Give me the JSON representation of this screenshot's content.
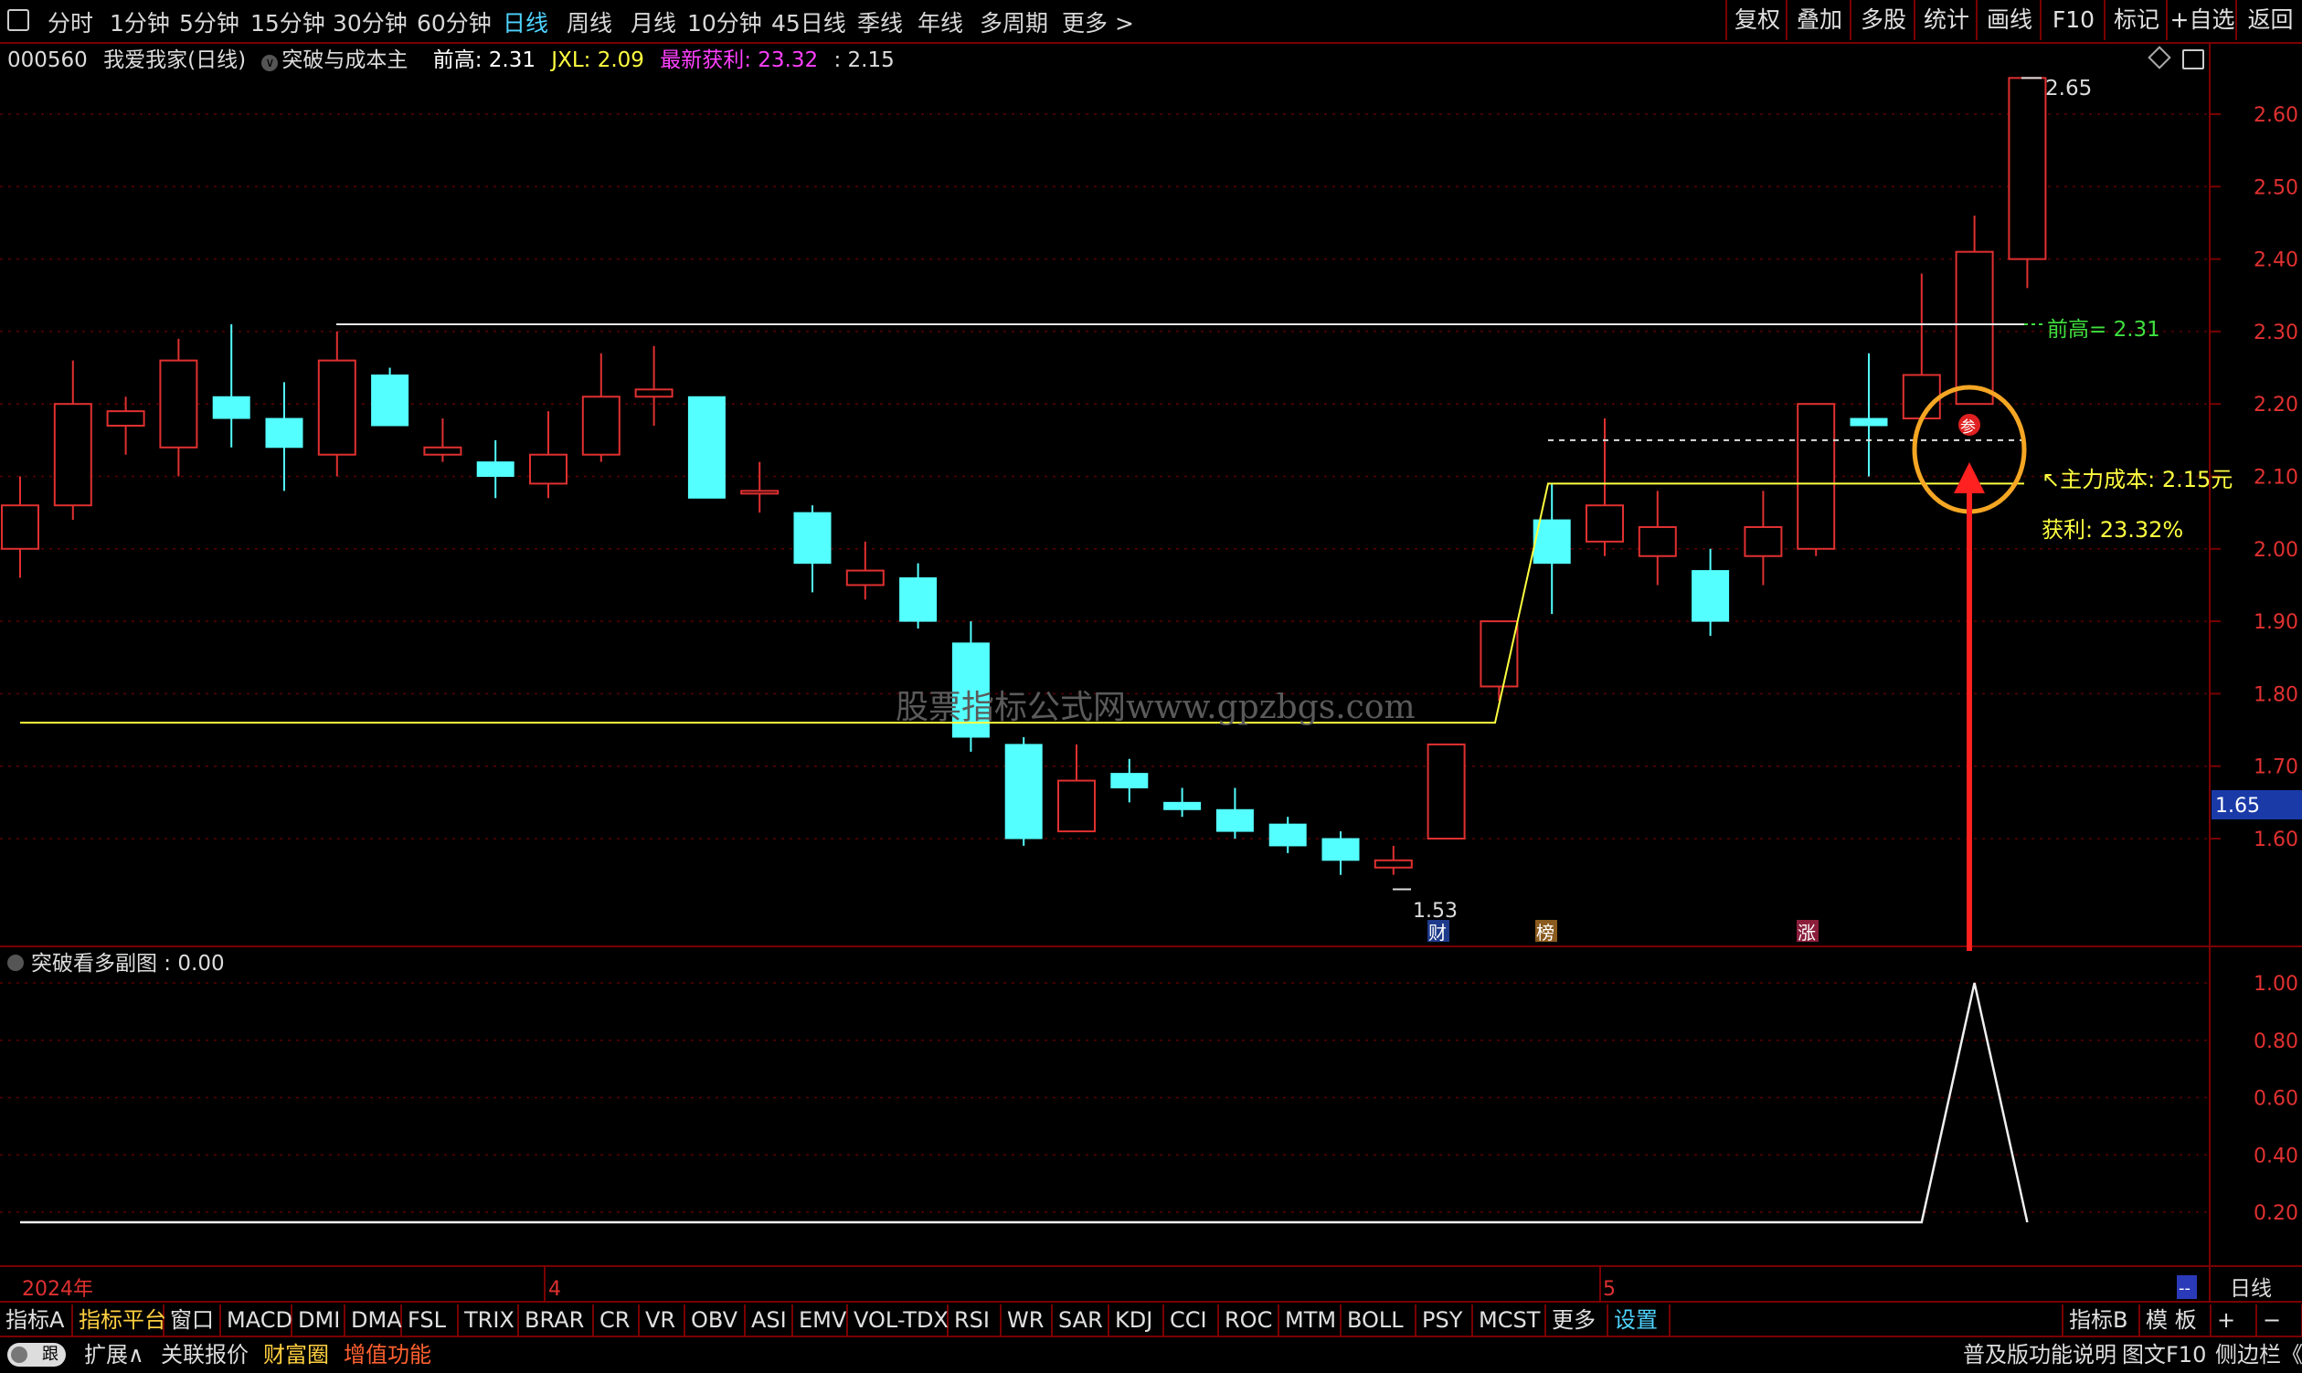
{
  "toolbar": {
    "periods": [
      "分时",
      "1分钟",
      "5分钟",
      "15分钟",
      "30分钟",
      "60分钟",
      "日线",
      "周线",
      "月线",
      "10分钟",
      "45日线",
      "季线",
      "年线",
      "多周期",
      "更多 >"
    ],
    "active_period": "日线",
    "right_buttons": [
      "复权",
      "叠加",
      "多股",
      "统计",
      "画线",
      "F10",
      "标记",
      "+自选",
      "返回"
    ]
  },
  "info": {
    "code": "000560",
    "name": "我爱我家(日线)",
    "indicator": "突破与成本主",
    "prev_high_label": "前高: 2.31",
    "jxl_label": "JXL: 2.09",
    "profit_label": "最新获利: 23.32",
    "extra_label": ": 2.15"
  },
  "price_axis": {
    "ticks": [
      "2.60",
      "2.50",
      "2.40",
      "2.30",
      "2.20",
      "2.10",
      "2.00",
      "1.90",
      "1.80",
      "1.70",
      "1.60"
    ],
    "current_price": "1.65"
  },
  "annotations": {
    "high_label": "2.65",
    "low_label": "1.53",
    "prev_high": "前高= 2.31",
    "cost": "主力成本: 2.15元",
    "profit": "获利: 23.32%",
    "watermark": "股票指标公式网www.gpzbgs.com",
    "badge_cai": "财",
    "badge_bang": "榜",
    "badge_zhang": "涨",
    "badge_can": "参"
  },
  "sub_panel": {
    "title": "突破看多副图 : 0.00",
    "ticks": [
      "1.00",
      "0.80",
      "0.60",
      "0.40",
      "0.20"
    ]
  },
  "time_axis": {
    "year": "2024年",
    "m4": "4",
    "m5": "5",
    "period": "日线",
    "dash": "--"
  },
  "bottom_tabs": [
    "指标A",
    "指标平台",
    "窗口",
    "MACD",
    "DMI",
    "DMA",
    "FSL",
    "TRIX",
    "BRAR",
    "CR",
    "VR",
    "OBV",
    "ASI",
    "EMV",
    "VOL-TDX",
    "RSI",
    "WR",
    "SAR",
    "KDJ",
    "CCI",
    "ROC",
    "MTM",
    "BOLL",
    "PSY",
    "MCST",
    "更多",
    "设置"
  ],
  "bottom_right": [
    "指标B",
    "模 板",
    "+",
    "−"
  ],
  "status": {
    "toggle": "跟",
    "expand": "扩展∧",
    "quote": "关联报价",
    "wealth": "财富圈",
    "value_add": "增值功能",
    "help": "普及版功能说明",
    "f10": "图文F10",
    "side": "侧边栏《"
  },
  "colors": {
    "up": "#e03030",
    "down": "#54ffff",
    "line_yellow": "#ffff40",
    "accent": "#4fd4ff"
  },
  "chart_data": {
    "type": "candlestick",
    "price_range": [
      1.5,
      2.7
    ],
    "candles": [
      [
        2.0,
        2.06,
        2.1,
        1.96
      ],
      [
        2.06,
        2.2,
        2.26,
        2.04
      ],
      [
        2.17,
        2.19,
        2.21,
        2.13
      ],
      [
        2.14,
        2.26,
        2.29,
        2.1
      ],
      [
        2.21,
        2.18,
        2.31,
        2.14
      ],
      [
        2.18,
        2.14,
        2.23,
        2.08
      ],
      [
        2.13,
        2.26,
        2.3,
        2.1
      ],
      [
        2.24,
        2.17,
        2.25,
        2.17
      ],
      [
        2.13,
        2.14,
        2.18,
        2.12
      ],
      [
        2.12,
        2.1,
        2.15,
        2.07
      ],
      [
        2.09,
        2.13,
        2.19,
        2.07
      ],
      [
        2.13,
        2.21,
        2.27,
        2.12
      ],
      [
        2.21,
        2.22,
        2.28,
        2.17
      ],
      [
        2.21,
        2.07,
        2.21,
        2.07
      ],
      [
        2.08,
        2.08,
        2.12,
        2.05
      ],
      [
        2.05,
        1.98,
        2.06,
        1.94
      ],
      [
        1.95,
        1.97,
        2.01,
        1.93
      ],
      [
        1.96,
        1.9,
        1.98,
        1.89
      ],
      [
        1.87,
        1.74,
        1.9,
        1.72
      ],
      [
        1.73,
        1.6,
        1.74,
        1.59
      ],
      [
        1.61,
        1.68,
        1.73,
        1.61
      ],
      [
        1.69,
        1.67,
        1.71,
        1.65
      ],
      [
        1.65,
        1.64,
        1.67,
        1.63
      ],
      [
        1.64,
        1.61,
        1.67,
        1.6
      ],
      [
        1.62,
        1.59,
        1.63,
        1.58
      ],
      [
        1.6,
        1.57,
        1.61,
        1.55
      ],
      [
        1.56,
        1.57,
        1.59,
        1.55
      ],
      [
        1.6,
        1.73,
        1.73,
        1.6
      ],
      [
        1.81,
        1.9,
        1.9,
        1.79
      ],
      [
        2.04,
        1.98,
        2.09,
        1.91
      ],
      [
        2.01,
        2.06,
        2.18,
        1.99
      ],
      [
        1.99,
        2.03,
        2.08,
        1.95
      ],
      [
        1.97,
        1.9,
        2.0,
        1.88
      ],
      [
        1.99,
        2.03,
        2.08,
        1.95
      ],
      [
        2.0,
        2.2,
        2.2,
        1.99
      ],
      [
        2.18,
        2.17,
        2.27,
        2.1
      ],
      [
        2.18,
        2.24,
        2.38,
        2.18
      ],
      [
        2.2,
        2.41,
        2.46,
        2.2
      ],
      [
        2.4,
        2.65,
        2.65,
        2.36
      ]
    ],
    "prev_high": 2.31,
    "cost_line": 2.09,
    "sub_series": [
      0,
      0,
      0,
      0,
      0,
      0,
      0,
      0,
      0,
      0,
      0,
      0,
      0,
      0,
      0,
      0,
      0,
      0,
      0,
      0,
      0,
      0,
      0,
      0,
      0,
      0,
      0,
      0,
      0,
      0,
      0,
      0,
      0,
      0,
      0,
      0,
      0,
      1,
      0
    ],
    "sub_range": [
      0,
      1.1
    ]
  }
}
